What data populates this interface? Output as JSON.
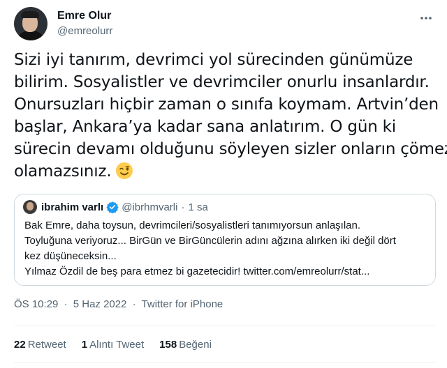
{
  "author": {
    "display_name": "Emre Olur",
    "handle": "@emreolurr"
  },
  "tweet": {
    "lines": [
      "Sizi iyi tanırım, devrimci yol sürecinden günümüze",
      "bilirim. Sosyalistler ve devrimciler onurlu insanlardır.",
      "Onursuzları hiçbir zaman o sınıfa koymam. Artvin’den",
      "başlar, Ankara’ya kadar sana anlatırım. O gün ki",
      "sürecin devamı olduğunu söyleyen sizler onların çömezi",
      "olamazsınız."
    ],
    "emoji": "winking-face"
  },
  "quoted": {
    "display_name": "ibrahim varlı",
    "handle": "@ibrhmvarli",
    "dot": "·",
    "time": "1 sa",
    "lines": [
      "Bak Emre, daha toysun, devrimcileri/sosyalistleri tanımıyorsun anlaşılan.",
      "Toyluğuna veriyoruz... BirGün ve BirGüncülerin adını ağzına alırken iki değil dört",
      "kez düşüneceksin...",
      "Yılmaz Özdil de beş para etmez bi gazetecidir! twitter.com/emreolurr/stat..."
    ]
  },
  "meta": {
    "time": "ÖS 10:29",
    "sep": "·",
    "date": "5 Haz 2022",
    "source": "Twitter for iPhone"
  },
  "stats": {
    "retweets": {
      "count": "22",
      "label": "Retweet"
    },
    "quotes": {
      "count": "1",
      "label": "Alıntı Tweet"
    },
    "likes": {
      "count": "158",
      "label": "Beğeni"
    }
  },
  "colors": {
    "text": "#0f1419",
    "secondary": "#536471",
    "verified": "#1d9bf0",
    "border": "#cfd9de"
  }
}
